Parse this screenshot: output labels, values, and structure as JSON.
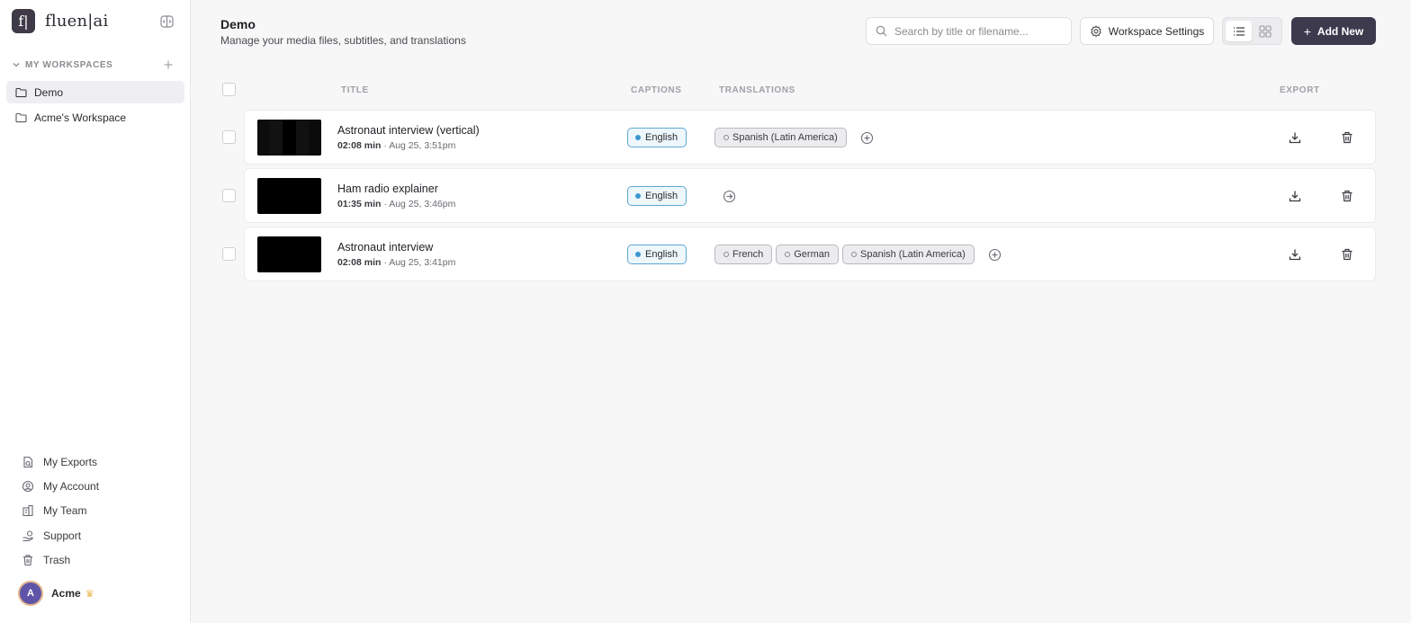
{
  "brand": {
    "logo_letter": "f|",
    "name": "fluen|ai"
  },
  "sidebar": {
    "workspaces_title": "MY WORKSPACES",
    "workspaces": [
      {
        "label": "Demo",
        "active": true
      },
      {
        "label": "Acme's Workspace",
        "active": false
      }
    ],
    "nav": [
      {
        "label": "My Exports",
        "icon": "exports-icon"
      },
      {
        "label": "My Account",
        "icon": "account-icon"
      },
      {
        "label": "My Team",
        "icon": "team-icon"
      },
      {
        "label": "Support",
        "icon": "support-icon"
      },
      {
        "label": "Trash",
        "icon": "trash-icon"
      }
    ],
    "user": {
      "initial": "A",
      "name": "Acme",
      "badge_icon": "crown-icon"
    }
  },
  "header": {
    "title": "Demo",
    "subtitle": "Manage your media files, subtitles, and translations",
    "search_placeholder": "Search by title or filename...",
    "settings_label": "Workspace Settings",
    "add_label": "Add New"
  },
  "table": {
    "columns": {
      "title": "TITLE",
      "captions": "CAPTIONS",
      "translations": "TRANSLATIONS",
      "export": "EXPORT"
    },
    "rows": [
      {
        "title": "Astronaut interview (vertical)",
        "duration": "02:08 min",
        "date": "· Aug 25, 3:51pm",
        "caption": "English",
        "translations": [
          "Spanish (Latin America)"
        ],
        "thumb": "vertical"
      },
      {
        "title": "Ham radio explainer",
        "duration": "01:35 min",
        "date": "· Aug 25, 3:46pm",
        "caption": "English",
        "translations": [],
        "thumb": "black"
      },
      {
        "title": "Astronaut interview",
        "duration": "02:08 min",
        "date": "· Aug 25, 3:41pm",
        "caption": "English",
        "translations": [
          "French",
          "German",
          "Spanish (Latin America)"
        ],
        "thumb": "black"
      }
    ]
  },
  "colors": {
    "accent": "#3e3a4e",
    "caption_blue": "#3d97d0"
  }
}
